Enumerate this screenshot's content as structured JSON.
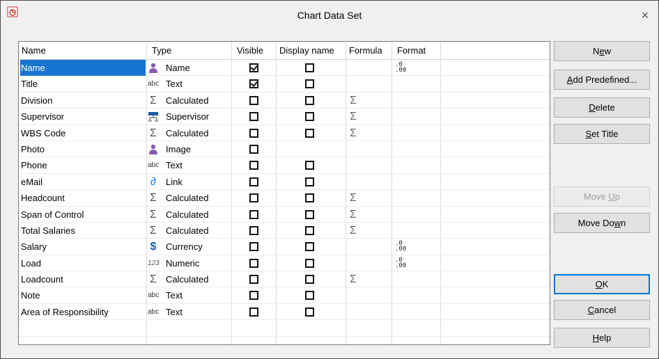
{
  "window": {
    "title": "Chart Data Set",
    "close_glyph": "×"
  },
  "columns": {
    "name": "Name",
    "type": "Type",
    "visible": "Visible",
    "display_name": "Display name",
    "formula": "Formula",
    "format": "Format"
  },
  "rows": [
    {
      "name": "Name",
      "type": "Name",
      "type_icon": "person-icon",
      "visible": true,
      "display": false,
      "formula": false,
      "format": true,
      "selected": true
    },
    {
      "name": "Title",
      "type": "Text",
      "type_icon": "abc-icon",
      "visible": true,
      "display": false,
      "formula": false,
      "format": false
    },
    {
      "name": "Division",
      "type": "Calculated",
      "type_icon": "sigma-icon",
      "visible": false,
      "display": false,
      "formula": true,
      "format": false
    },
    {
      "name": "Supervisor",
      "type": "Supervisor",
      "type_icon": "supervisor-icon",
      "visible": false,
      "display": false,
      "formula": true,
      "format": false
    },
    {
      "name": "WBS Code",
      "type": "Calculated",
      "type_icon": "sigma-icon",
      "visible": false,
      "display": false,
      "formula": true,
      "format": false
    },
    {
      "name": "Photo",
      "type": "Image",
      "type_icon": "person-icon",
      "visible": false,
      "display": null,
      "formula": false,
      "format": false
    },
    {
      "name": "Phone",
      "type": "Text",
      "type_icon": "abc-icon",
      "visible": false,
      "display": false,
      "formula": false,
      "format": false
    },
    {
      "name": "eMail",
      "type": "Link",
      "type_icon": "link-icon",
      "visible": false,
      "display": false,
      "formula": false,
      "format": false
    },
    {
      "name": "Headcount",
      "type": "Calculated",
      "type_icon": "sigma-icon",
      "visible": false,
      "display": false,
      "formula": true,
      "format": false
    },
    {
      "name": "Span of Control",
      "type": "Calculated",
      "type_icon": "sigma-icon",
      "visible": false,
      "display": false,
      "formula": true,
      "format": false
    },
    {
      "name": "Total Salaries",
      "type": "Calculated",
      "type_icon": "sigma-icon",
      "visible": false,
      "display": false,
      "formula": true,
      "format": false
    },
    {
      "name": "Salary",
      "type": "Currency",
      "type_icon": "dollar-icon",
      "visible": false,
      "display": false,
      "formula": false,
      "format": true
    },
    {
      "name": "Load",
      "type": "Numeric",
      "type_icon": "numeric-icon",
      "visible": false,
      "display": false,
      "formula": false,
      "format": true
    },
    {
      "name": "Loadcount",
      "type": "Calculated",
      "type_icon": "sigma-icon",
      "visible": false,
      "display": false,
      "formula": true,
      "format": false
    },
    {
      "name": "Note",
      "type": "Text",
      "type_icon": "abc-icon",
      "visible": false,
      "display": false,
      "formula": false,
      "format": false
    },
    {
      "name": "Area of Responsibility",
      "type": "Text",
      "type_icon": "abc-icon",
      "visible": false,
      "display": false,
      "formula": false,
      "format": false
    }
  ],
  "glyphs": {
    "abc": "abc",
    "sigma": "Σ",
    "dollar": "$",
    "link": "∂",
    "numeric": "123",
    "format": ".0\n.00"
  },
  "buttons": [
    {
      "key": "new",
      "pre": "N",
      "mn": "e",
      "post": "w",
      "enabled": true
    },
    {
      "key": "add_predefined",
      "pre": "",
      "mn": "A",
      "post": "dd Predefined...",
      "enabled": true
    },
    {
      "key": "delete",
      "pre": "",
      "mn": "D",
      "post": "elete",
      "enabled": true
    },
    {
      "key": "set_title",
      "pre": "",
      "mn": "S",
      "post": "et Title",
      "enabled": true
    },
    {
      "key": "move_up",
      "pre": "Move ",
      "mn": "U",
      "post": "p",
      "enabled": false
    },
    {
      "key": "move_down",
      "pre": "Move Do",
      "mn": "w",
      "post": "n",
      "enabled": true
    },
    {
      "key": "ok",
      "pre": "",
      "mn": "O",
      "post": "K",
      "enabled": true,
      "default": true
    },
    {
      "key": "cancel",
      "pre": "",
      "mn": "C",
      "post": "ancel",
      "enabled": true
    },
    {
      "key": "help",
      "pre": "",
      "mn": "H",
      "post": "elp",
      "enabled": true
    }
  ],
  "colors": {
    "selection": "#1874d1",
    "person_icon": "#8a5cb0",
    "dollar": "#1e5aa8",
    "link": "#1e7fd4"
  }
}
